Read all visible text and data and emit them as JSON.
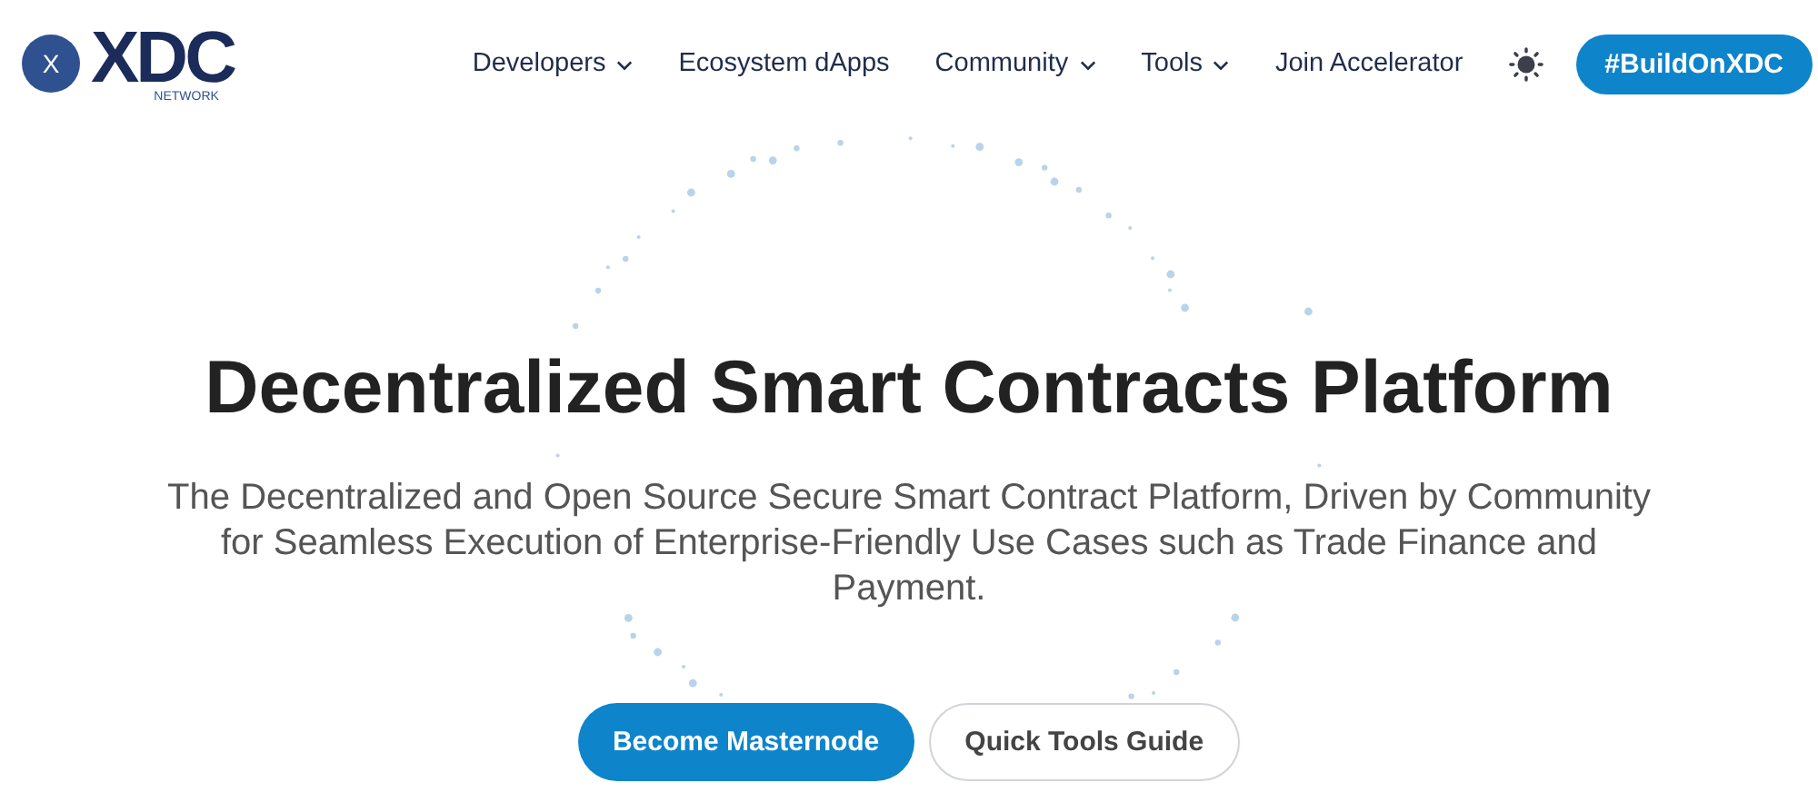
{
  "logo": {
    "mark": "X",
    "wordmark": "XDC",
    "tagline": "NETWORK"
  },
  "nav": [
    {
      "label": "Developers",
      "kind": "dropdown"
    },
    {
      "label": "Ecosystem dApps",
      "kind": "link"
    },
    {
      "label": "Community",
      "kind": "dropdown"
    },
    {
      "label": "Tools",
      "kind": "dropdown"
    },
    {
      "label": "Join Accelerator",
      "kind": "link"
    }
  ],
  "cta": "#BuildOnXDC",
  "hero": {
    "title": "Decentralized Smart Contracts Platform",
    "subtitle": "The Decentralized and Open Source Secure Smart Contract Platform, Driven by Community for Seamless Execution of Enterprise-Friendly Use Cases such as Trade Finance and Payment.",
    "buttons": [
      {
        "label": "Become Masternode",
        "kind": "primary"
      },
      {
        "label": "Quick Tools Guide",
        "kind": "outline"
      }
    ]
  }
}
